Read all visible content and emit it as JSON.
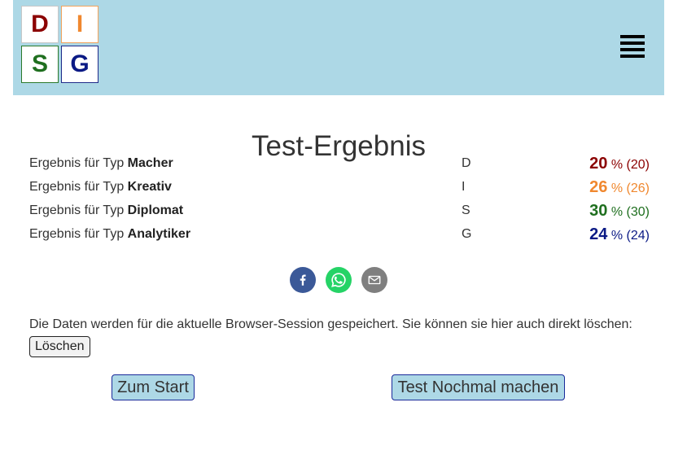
{
  "colors": {
    "header_bg": "#add8e6",
    "d": "#8b0000",
    "i": "#f0882f",
    "s": "#1f6f1f",
    "g": "#0b1a85",
    "facebook": "#3b5998",
    "whatsapp": "#25d366",
    "email": "#7f7f7f"
  },
  "logo": {
    "letters": [
      "D",
      "I",
      "S",
      "G"
    ]
  },
  "header": {
    "menu_icon": "hamburger-icon"
  },
  "page": {
    "title": "Test-Ergebnis"
  },
  "results": [
    {
      "prefix": "Ergebnis für Typ",
      "type": "Macher",
      "letter": "D",
      "percent": "20",
      "unit": "%",
      "raw": "(20)"
    },
    {
      "prefix": "Ergebnis für Typ",
      "type": "Kreativ",
      "letter": "I",
      "percent": "26",
      "unit": "%",
      "raw": "(26)"
    },
    {
      "prefix": "Ergebnis für Typ",
      "type": "Diplomat",
      "letter": "S",
      "percent": "30",
      "unit": "%",
      "raw": "(30)"
    },
    {
      "prefix": "Ergebnis für Typ",
      "type": "Analytiker",
      "letter": "G",
      "percent": "24",
      "unit": "%",
      "raw": "(24)"
    }
  ],
  "share": {
    "icons": [
      "facebook-icon",
      "whatsapp-icon",
      "email-icon"
    ]
  },
  "notice": {
    "text": "Die Daten werden für die aktuelle Browser-Session gespeichert. Sie können sie hier auch direkt löschen:",
    "delete_label": "Löschen"
  },
  "buttons": {
    "start": "Zum Start",
    "again": "Test Nochmal machen"
  }
}
